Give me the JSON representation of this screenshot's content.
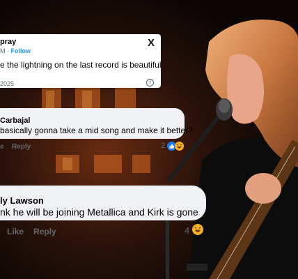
{
  "tweet": {
    "name": "pray",
    "handle_suffix": "M · ",
    "follow_label": "Follow",
    "text": "e the lightning on the last record is beautiful",
    "date": "2025",
    "logo": "X",
    "info_icon": "info-icon"
  },
  "comment_1": {
    "name": "Carbajal",
    "text": "basically gonna take a mid song and make it better?",
    "like_label": "e",
    "reply_label": "Reply",
    "reaction_count": "2",
    "reactions": [
      "like-reaction-icon",
      "haha-reaction-icon"
    ]
  },
  "comment_2": {
    "name": "ly Lawson",
    "text": "nk he will be joining Metallica and Kirk is gone",
    "like_label": "Like",
    "reply_label": "Reply",
    "reaction_count": "4",
    "reactions": [
      "haha-reaction-icon"
    ]
  },
  "colors": {
    "facebook_blue": "#1877f2",
    "twitter_blue": "#1d9bf0",
    "haha_yellow": "#f7b125",
    "muted_text": "#65676b"
  }
}
